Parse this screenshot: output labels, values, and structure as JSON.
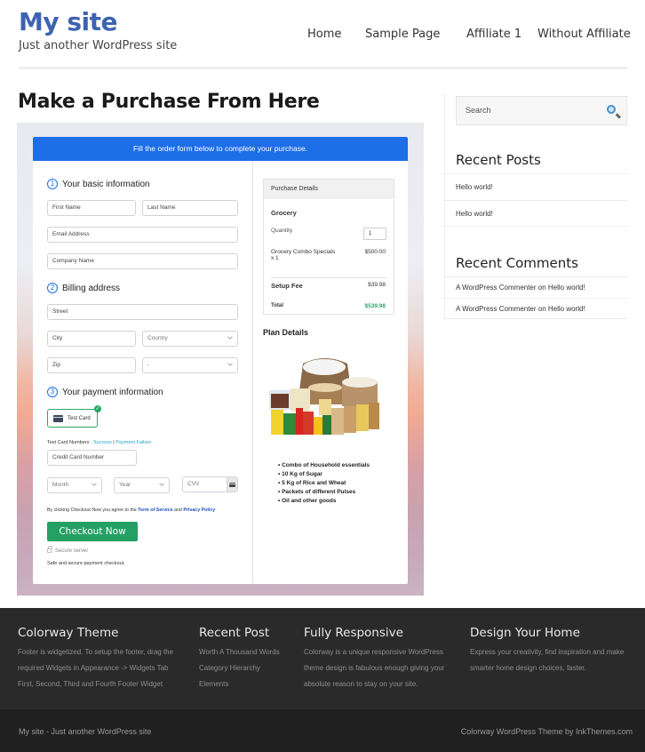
{
  "header": {
    "site_title": "My site",
    "tagline": "Just another WordPress site",
    "nav": [
      "Home",
      "Sample Page",
      "Affiliate 1",
      "Without Affiliate"
    ]
  },
  "page_title": "Make a Purchase From Here",
  "form": {
    "banner": "Fill the order form below to complete your purchase.",
    "section1": {
      "num": "1",
      "title": "Your basic information"
    },
    "first_name_placeholder": "First Name",
    "last_name_placeholder": "Last Name",
    "email_placeholder": "Email Address",
    "company_placeholder": "Company Name",
    "section2": {
      "num": "2",
      "title": "Billing address"
    },
    "street_placeholder": "Street",
    "city_placeholder": "City",
    "country_select": "Country",
    "zip_placeholder": "Zip",
    "state_select": "-",
    "section3": {
      "num": "3",
      "title": "Your payment information"
    },
    "payment_option": "Test Card",
    "test_card_label": "Test Card Numbers : ",
    "test_success": "Success",
    "test_separator": " | ",
    "test_failure": "Payment Failure",
    "card_number_placeholder": "Credit Card Number",
    "month_select": "Month",
    "year_select": "Year",
    "cvv_placeholder": "CVV",
    "agree_prefix": "By clicking Checkout Now you agree to the ",
    "terms_link": "Term of Service",
    "agree_and": " and ",
    "privacy_link": "Privacy Policy",
    "checkout_button": "Checkout Now",
    "secure_server": "Secure server",
    "secure_note": "Safe and secure payment checkout."
  },
  "purchase_details": {
    "title": "Purchase Details",
    "product_group": "Grocery",
    "quantity_label": "Quantity",
    "quantity_value": "1",
    "item_name_line1": "Grocery Combo Specials",
    "item_name_line2": "x 1",
    "item_price": "$500.00",
    "setup_fee_label": "Setup Fee",
    "setup_fee_value": "$39.98",
    "total_label": "Total",
    "total_value": "$539.98",
    "total_color": "#2aa768"
  },
  "plan_details": {
    "title": "Plan Details",
    "items": [
      "Combo of Household essentials",
      "10 Kg of Sugar",
      "5 Kg of Rice and Wheat",
      "Packets of different Pulses",
      "Oil and other goods"
    ]
  },
  "sidebar": {
    "search_placeholder": "Search",
    "recent_posts_title": "Recent Posts",
    "recent_posts": [
      "Hello world!",
      "Hello world!"
    ],
    "recent_comments_title": "Recent Comments",
    "recent_comments": [
      {
        "author": "A WordPress Commenter",
        "on": " on ",
        "post": "Hello world!"
      },
      {
        "author": "A WordPress Commenter",
        "on": " on ",
        "post": "Hello world!"
      }
    ]
  },
  "footer": {
    "columns": [
      {
        "title": "Colorway Theme",
        "lines": [
          "Footer is widgetized. To setup the footer, drag the",
          "required Widgets in Appearance -> Widgets Tab",
          "First, Second, Third and Fourth Footer Widget"
        ]
      },
      {
        "title": "Recent Post",
        "lines": [
          "Worth A Thousand Words",
          "Category Hierarchy",
          "Elements"
        ]
      },
      {
        "title": "Fully Responsive",
        "lines": [
          "Colorway is a unique responsive WordPress",
          "theme design is fabulous enough giving your",
          "absolute reason to stay on your site."
        ]
      },
      {
        "title": "Design Your Home",
        "lines": [
          "Express your creativity, find inspiration and make",
          "smarter home design choices, faster."
        ]
      }
    ],
    "bottom_left": "My site - Just another WordPress site",
    "bottom_right": "Colorway WordPress Theme by InkThemes.com"
  },
  "colors": {
    "brand_blue": "#3e63b0",
    "banner_blue": "#1e6ee8",
    "checkout_green": "#24a064",
    "footer_bg": "#2a2a2a"
  }
}
